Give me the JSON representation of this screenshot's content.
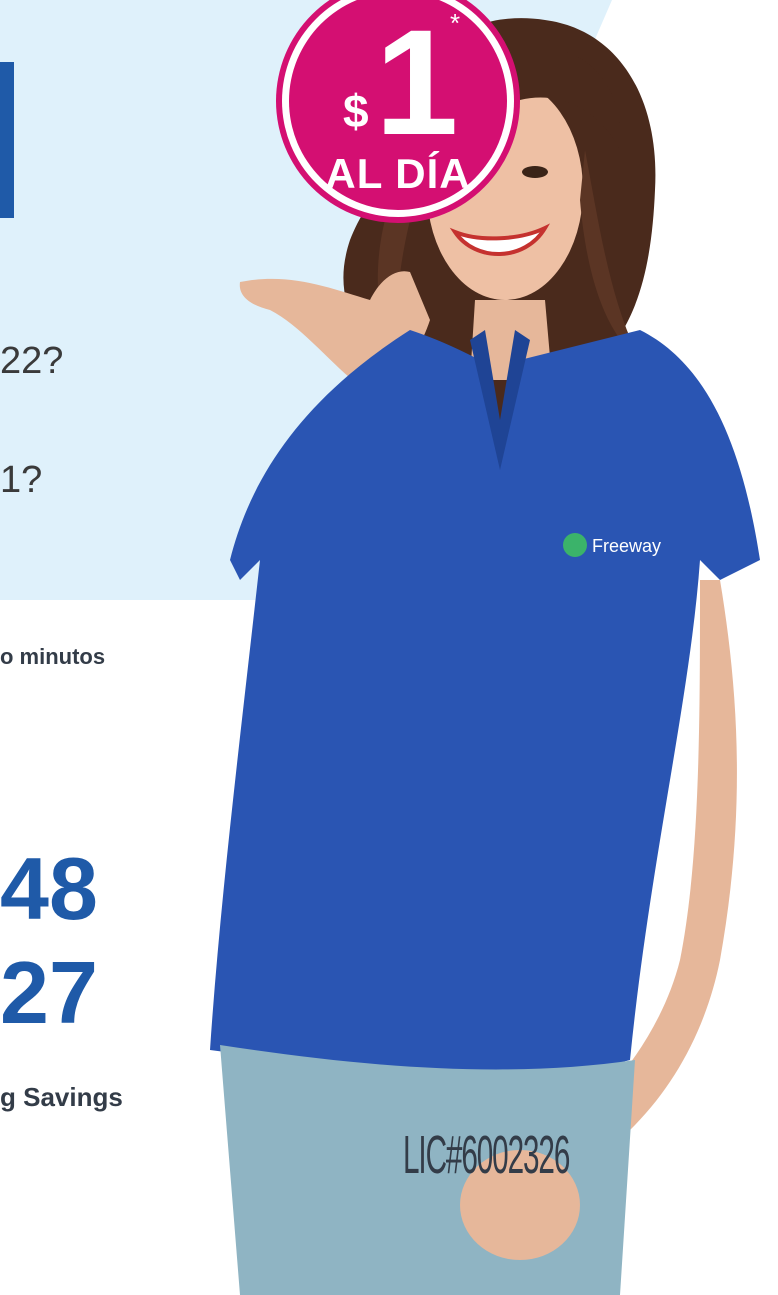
{
  "badge": {
    "currency": "$",
    "amount": "1",
    "asterisk": "*",
    "period": "AL DÍA"
  },
  "question_1": "22?",
  "question_2": "1?",
  "minutes_text": "o minutos",
  "phone_1": "48",
  "phone_2": "27",
  "savings_text": "g Savings",
  "license": "LIC#6002326",
  "shirt_logo": "Freeway",
  "colors": {
    "panel_light_blue": "#dff1fb",
    "brand_blue": "#1f5aa8",
    "badge_magenta": "#d40f72",
    "text_dark": "#333c48"
  }
}
